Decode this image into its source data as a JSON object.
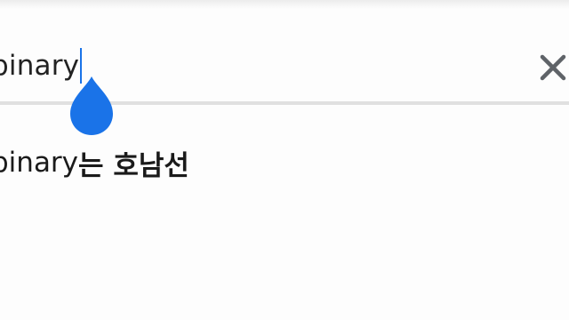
{
  "search": {
    "query": "binary"
  },
  "suggestions": [
    {
      "prefix": "binary",
      "completion": "는 호남선"
    }
  ],
  "colors": {
    "accent": "#1a73e8",
    "divider": "#e0e0e0",
    "text": "#222222"
  },
  "icons": {
    "clear": "close-icon",
    "handle": "selection-handle-icon"
  }
}
